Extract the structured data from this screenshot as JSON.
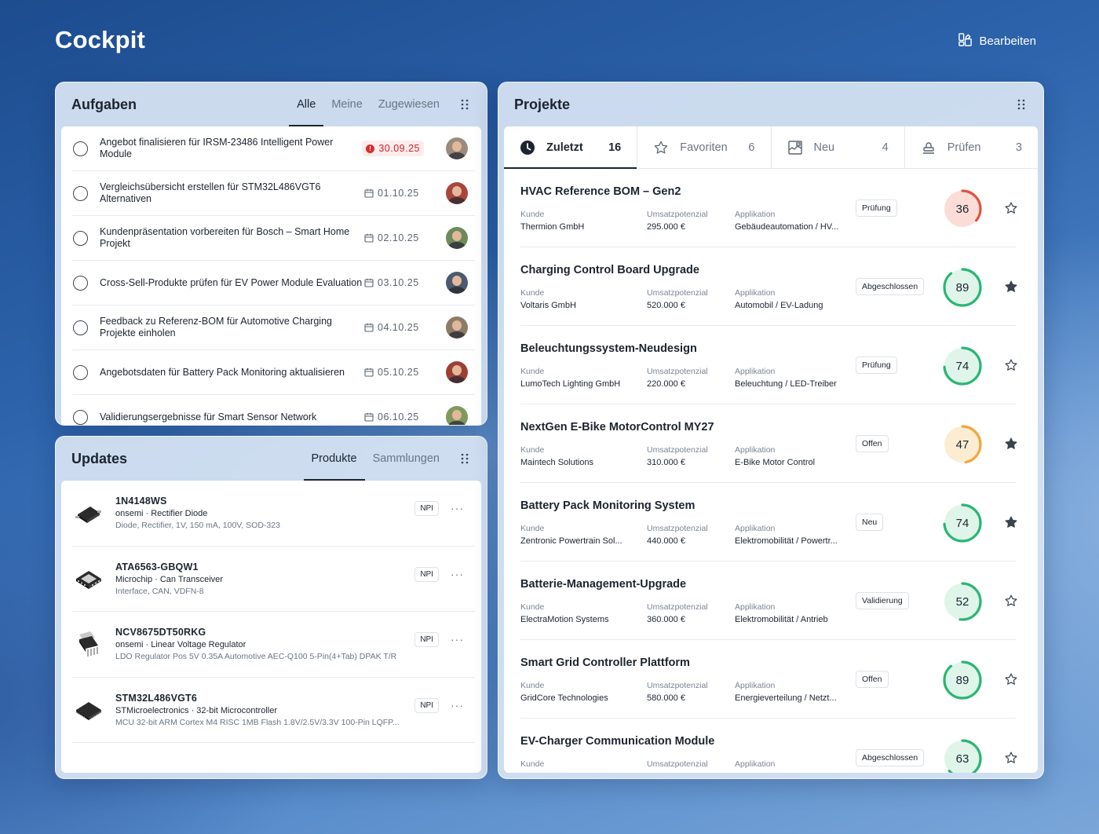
{
  "app": {
    "title": "Cockpit",
    "edit_label": "Bearbeiten"
  },
  "tasks": {
    "title": "Aufgaben",
    "tabs": [
      "Alle",
      "Meine",
      "Zugewiesen"
    ],
    "active_tab": "Alle",
    "items": [
      {
        "text": "Angebot finalisieren für IRSM-23486 Intelligent Power Module",
        "date": "30.09.25",
        "overdue": true
      },
      {
        "text": "Vergleichsübersicht erstellen für STM32L486VGT6 Alternativen",
        "date": "01.10.25",
        "overdue": false
      },
      {
        "text": "Kundenpräsentation vorbereiten für Bosch – Smart Home Projekt",
        "date": "02.10.25",
        "overdue": false
      },
      {
        "text": "Cross-Sell-Produkte prüfen für EV Power Module Evaluation",
        "date": "03.10.25",
        "overdue": false
      },
      {
        "text": "Feedback zu Referenz-BOM für Automotive Charging Projekte einholen",
        "date": "04.10.25",
        "overdue": false
      },
      {
        "text": "Angebotsdaten für Battery Pack Monitoring aktualisieren",
        "date": "05.10.25",
        "overdue": false
      },
      {
        "text": "Validierungsergebnisse für Smart Sensor Network",
        "date": "06.10.25",
        "overdue": false
      }
    ]
  },
  "updates": {
    "title": "Updates",
    "tabs": [
      "Produkte",
      "Sammlungen"
    ],
    "active_tab": "Produkte",
    "items": [
      {
        "name": "1N4148WS",
        "maker": "onsemi · Rectifier Diode",
        "desc": "Diode, Rectifier, 1V, 150 mA, 100V, SOD-323",
        "badge": "NPI",
        "icon": "diode-package-icon"
      },
      {
        "name": "ATA6563-GBQW1",
        "maker": "Microchip · Can Transceiver",
        "desc": "Interface, CAN, VDFN-8",
        "badge": "NPI",
        "icon": "vdfn-package-icon"
      },
      {
        "name": "NCV8675DT50RKG",
        "maker": "onsemi · Linear Voltage Regulator",
        "desc": "LDO Regulator Pos 5V 0.35A Automotive AEC-Q100 5-Pin(4+Tab) DPAK T/R",
        "badge": "NPI",
        "icon": "dpak-package-icon"
      },
      {
        "name": "STM32L486VGT6",
        "maker": "STMicroelectronics · 32-bit Microcontroller",
        "desc": "MCU 32-bit ARM Cortex M4 RISC 1MB Flash 1.8V/2.5V/3.3V 100-Pin LQFP...",
        "badge": "NPI",
        "icon": "lqfp-package-icon"
      }
    ]
  },
  "projects": {
    "title": "Projekte",
    "tabs": [
      {
        "label": "Zuletzt",
        "count": "16",
        "icon": "clock-icon"
      },
      {
        "label": "Favoriten",
        "count": "6",
        "icon": "star-outline-icon"
      },
      {
        "label": "Neu",
        "count": "4",
        "icon": "chart-frame-icon"
      },
      {
        "label": "Prüfen",
        "count": "3",
        "icon": "stamp-icon"
      }
    ],
    "active_tab": "Zuletzt",
    "field_labels": {
      "customer": "Kunde",
      "revenue": "Umsatzpotenzial",
      "application": "Applikation"
    },
    "items": [
      {
        "name": "HVAC Reference BOM – Gen2",
        "customer": "Thermion GmbH",
        "revenue": "295.000 €",
        "application": "Gebäudeautomation / HV...",
        "status": "Prüfung",
        "score": 36,
        "score_color": "#e0533d",
        "score_bg": "#fbdcd6",
        "favorite": false
      },
      {
        "name": "Charging Control Board Upgrade",
        "customer": "Voltaris GmbH",
        "revenue": "520.000 €",
        "application": "Automobil / EV-Ladung",
        "status": "Abgeschlossen",
        "score": 89,
        "score_color": "#2bb673",
        "score_bg": "#dff5ea",
        "favorite": true
      },
      {
        "name": "Beleuchtungssystem-Neudesign",
        "customer": "LumoTech Lighting GmbH",
        "revenue": "220.000 €",
        "application": "Beleuchtung / LED-Treiber",
        "status": "Prüfung",
        "score": 74,
        "score_color": "#2bb673",
        "score_bg": "#dff5ea",
        "favorite": false
      },
      {
        "name": "NextGen E-Bike MotorControl MY27",
        "customer": "Maintech Solutions",
        "revenue": "310.000 €",
        "application": "E-Bike Motor Control",
        "status": "Offen",
        "score": 47,
        "score_color": "#f0a640",
        "score_bg": "#fcecd2",
        "favorite": true
      },
      {
        "name": "Battery Pack Monitoring System",
        "customer": "Zentronic Powertrain Sol...",
        "revenue": "440.000 €",
        "application": "Elektromobilität / Powertr...",
        "status": "Neu",
        "score": 74,
        "score_color": "#2bb673",
        "score_bg": "#dff5ea",
        "favorite": true
      },
      {
        "name": "Batterie-Management-Upgrade",
        "customer": "ElectraMotion Systems",
        "revenue": "360.000 €",
        "application": "Elektromobilität / Antrieb",
        "status": "Validierung",
        "score": 52,
        "score_color": "#2bb673",
        "score_bg": "#dff5ea",
        "favorite": false
      },
      {
        "name": "Smart Grid Controller Plattform",
        "customer": "GridCore Technologies",
        "revenue": "580.000 €",
        "application": "Energieverteilung / Netzt...",
        "status": "Offen",
        "score": 89,
        "score_color": "#2bb673",
        "score_bg": "#dff5ea",
        "favorite": false
      },
      {
        "name": "EV-Charger Communication Module",
        "customer": "",
        "revenue": "",
        "application": "",
        "status": "Abgeschlossen",
        "score": 63,
        "score_color": "#2bb673",
        "score_bg": "#dff5ea",
        "favorite": false
      }
    ]
  }
}
